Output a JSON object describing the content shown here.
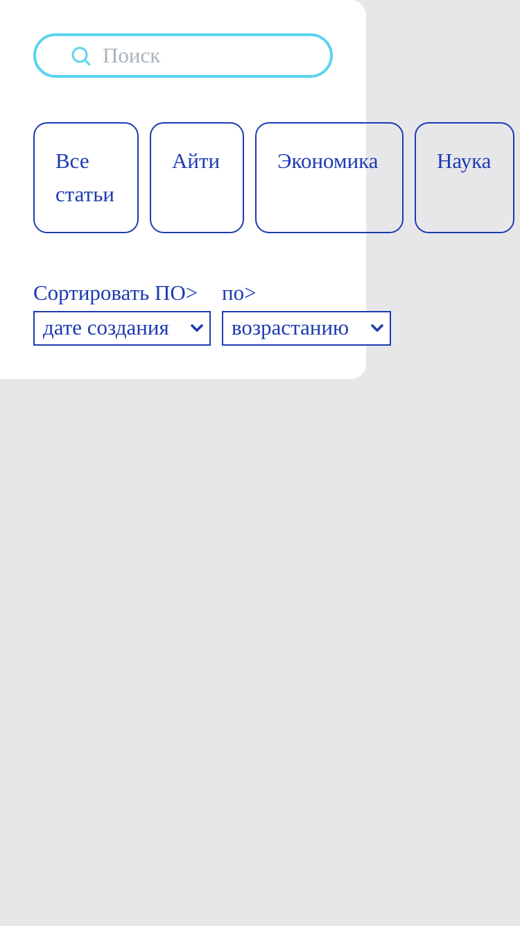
{
  "search": {
    "placeholder": "Поиск",
    "icon": "search-icon"
  },
  "categories": [
    {
      "label": "Все статьи"
    },
    {
      "label": "Айти"
    },
    {
      "label": "Экономика"
    },
    {
      "label": "Наука"
    }
  ],
  "sort": {
    "label_field": "Сортировать ПО>",
    "label_order": "по>",
    "field_value": "дате создания",
    "order_value": "возрастанию"
  },
  "colors": {
    "accent": "#1d3bb0",
    "search_border": "#5bd3ef",
    "placeholder": "#a7b3bd",
    "background": "#e7e7ea",
    "panel": "#ffffff"
  }
}
